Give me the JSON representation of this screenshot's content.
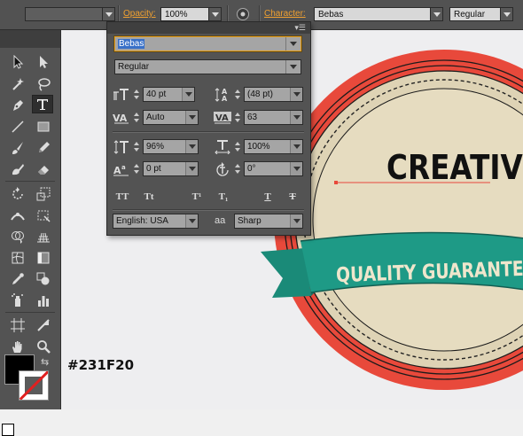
{
  "control_bar": {
    "opacity_label": "Opacity:",
    "opacity_value": "100%",
    "character_label": "Character:",
    "font_family": "Bebas",
    "font_style": "Regular"
  },
  "character_panel": {
    "font_family": "Bebas",
    "font_style": "Regular",
    "font_size": "40 pt",
    "leading": "(48 pt)",
    "kerning": "Auto",
    "tracking": "63",
    "vertical_scale": "96%",
    "horizontal_scale": "100%",
    "baseline_shift": "0 pt",
    "rotation": "0°",
    "type_buttons": [
      "TT",
      "Tt",
      "T¹",
      "T₁",
      "T",
      "T"
    ],
    "language": "English: USA",
    "antialias_icon": "aa",
    "antialiasing": "Sharp"
  },
  "artwork": {
    "title": "CREATIVE",
    "ribbon_text": "QUALITY GUARANTEED"
  },
  "fill_color_hex": "#231F20",
  "colors": {
    "badge_outer": "#e8493b",
    "badge_inner": "#ded3b5",
    "ribbon": "#1e9a86",
    "ribbon_dark": "#176e60",
    "fill": "#000000"
  }
}
